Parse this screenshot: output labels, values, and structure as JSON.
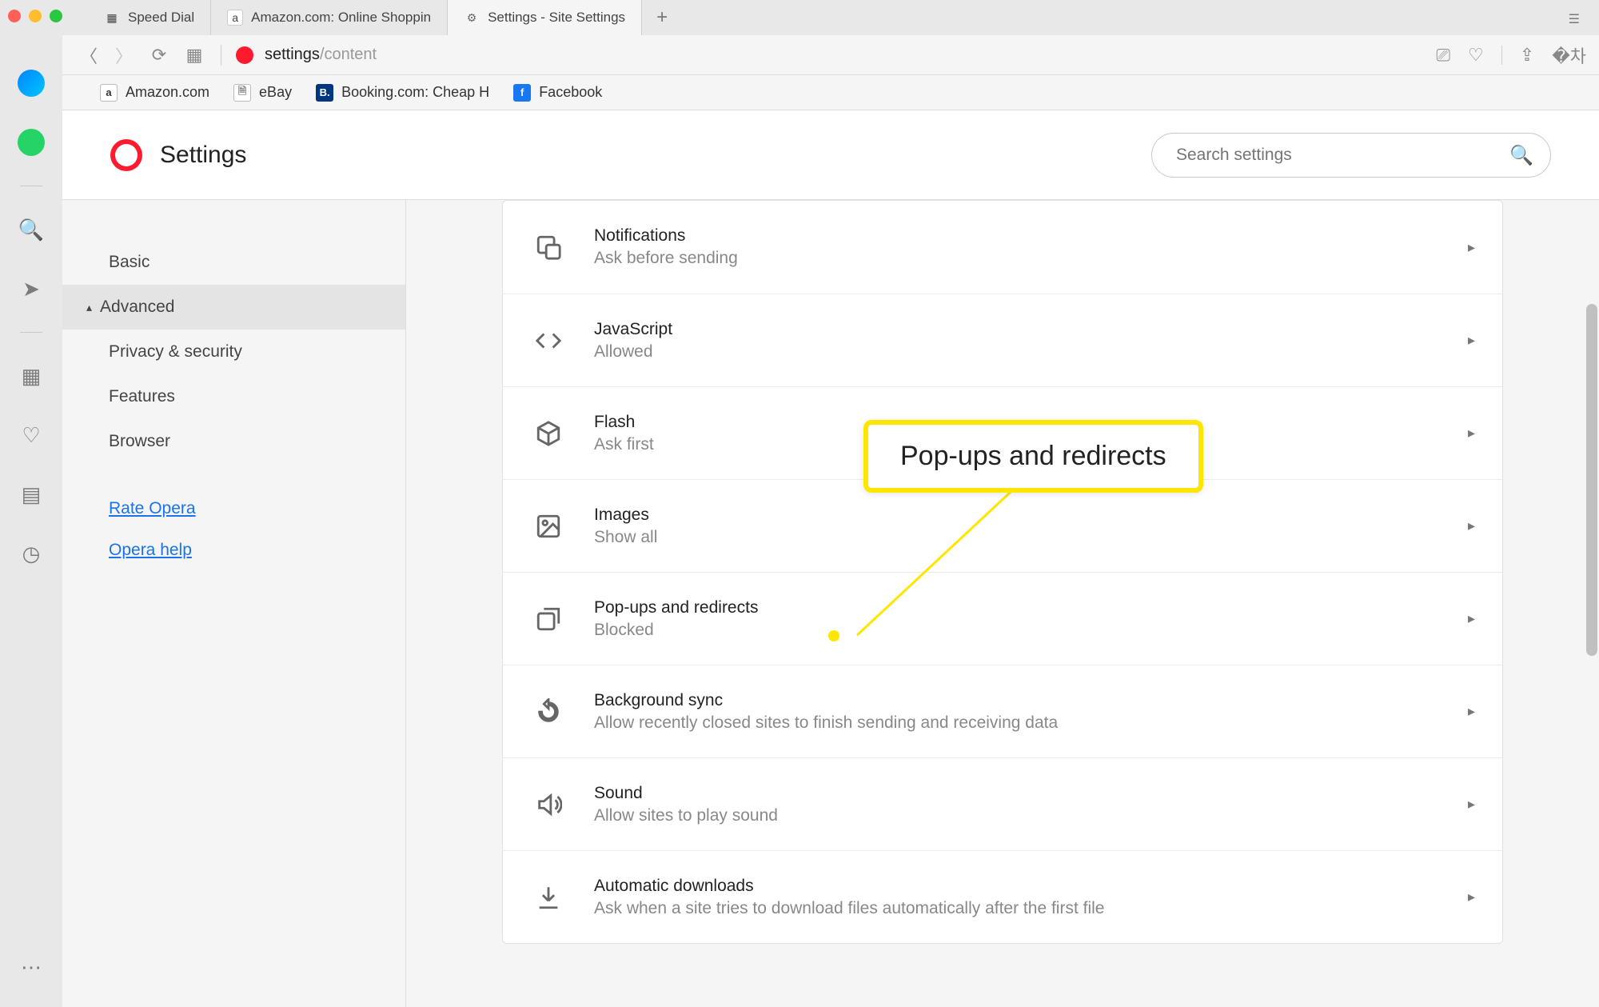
{
  "tabs": [
    {
      "label": "Speed Dial",
      "icon": "grid"
    },
    {
      "label": "Amazon.com: Online Shoppin",
      "icon": "amazon"
    },
    {
      "label": "Settings - Site Settings",
      "icon": "gear",
      "active": true
    }
  ],
  "address": {
    "prefix": "settings",
    "suffix": "/content"
  },
  "bookmarks": [
    {
      "label": "Amazon.com",
      "icon": "amazon"
    },
    {
      "label": "eBay",
      "icon": "file"
    },
    {
      "label": "Booking.com: Cheap H",
      "icon": "booking"
    },
    {
      "label": "Facebook",
      "icon": "fb"
    }
  ],
  "settings_title": "Settings",
  "search_placeholder": "Search settings",
  "leftnav": {
    "basic": "Basic",
    "advanced": "Advanced",
    "sub": [
      "Privacy & security",
      "Features",
      "Browser"
    ],
    "rate": "Rate Opera",
    "help": "Opera help"
  },
  "rows": [
    {
      "title": "Notifications",
      "sub": "Ask before sending",
      "icon": "notify"
    },
    {
      "title": "JavaScript",
      "sub": "Allowed",
      "icon": "code"
    },
    {
      "title": "Flash",
      "sub": "Ask first",
      "icon": "cube"
    },
    {
      "title": "Images",
      "sub": "Show all",
      "icon": "image"
    },
    {
      "title": "Pop-ups and redirects",
      "sub": "Blocked",
      "icon": "popup"
    },
    {
      "title": "Background sync",
      "sub": "Allow recently closed sites to finish sending and receiving data",
      "icon": "sync"
    },
    {
      "title": "Sound",
      "sub": "Allow sites to play sound",
      "icon": "sound"
    },
    {
      "title": "Automatic downloads",
      "sub": "Ask when a site tries to download files automatically after the first file",
      "icon": "download"
    }
  ],
  "callout": "Pop-ups and redirects"
}
